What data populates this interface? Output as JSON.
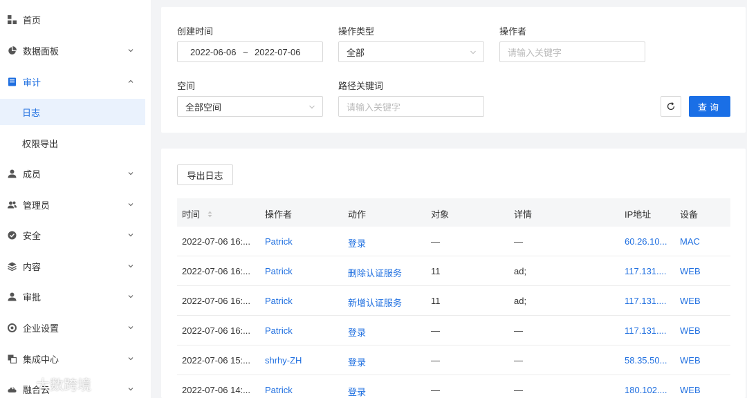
{
  "sidebar": {
    "items": [
      {
        "label": "首页",
        "icon": "grid-icon"
      },
      {
        "label": "数据面板",
        "icon": "pie-chart-icon"
      },
      {
        "label": "审计",
        "icon": "document-icon"
      },
      {
        "label": "日志"
      },
      {
        "label": "权限导出"
      },
      {
        "label": "成员",
        "icon": "user-icon"
      },
      {
        "label": "管理员",
        "icon": "admin-users-icon"
      },
      {
        "label": "安全",
        "icon": "shield-check-icon"
      },
      {
        "label": "内容",
        "icon": "layers-icon"
      },
      {
        "label": "审批",
        "icon": "approval-user-icon"
      },
      {
        "label": "企业设置",
        "icon": "settings-icon"
      },
      {
        "label": "集成中心",
        "icon": "integration-icon"
      },
      {
        "label": "融合云",
        "icon": "cloud-icon"
      }
    ]
  },
  "filters": {
    "created_time_label": "创建时间",
    "date_start": "2022-06-06",
    "date_sep": "~",
    "date_end": "2022-07-06",
    "op_type_label": "操作类型",
    "op_type_value": "全部",
    "operator_label": "操作者",
    "operator_placeholder": "请输入关键字",
    "space_label": "空间",
    "space_value": "全部空间",
    "path_label": "路径关键词",
    "path_placeholder": "请输入关键字",
    "query_button": "查询"
  },
  "list": {
    "export_button": "导出日志",
    "columns": [
      "时间",
      "操作者",
      "动作",
      "对象",
      "详情",
      "IP地址",
      "设备"
    ],
    "rows": [
      {
        "time": "2022-07-06 16:...",
        "operator": "Patrick",
        "action": "登录",
        "object": "—",
        "detail": "—",
        "ip": "60.26.10...",
        "device": "MAC"
      },
      {
        "time": "2022-07-06 16:...",
        "operator": "Patrick",
        "action": "删除认证服务",
        "object": "11",
        "detail": "ad;",
        "ip": "117.131....",
        "device": "WEB"
      },
      {
        "time": "2022-07-06 16:...",
        "operator": "Patrick",
        "action": "新增认证服务",
        "object": "11",
        "detail": "ad;",
        "ip": "117.131....",
        "device": "WEB"
      },
      {
        "time": "2022-07-06 16:...",
        "operator": "Patrick",
        "action": "登录",
        "object": "—",
        "detail": "—",
        "ip": "117.131....",
        "device": "WEB"
      },
      {
        "time": "2022-07-06 15:...",
        "operator": "shrhy-ZH",
        "action": "登录",
        "object": "—",
        "detail": "—",
        "ip": "58.35.50...",
        "device": "WEB"
      },
      {
        "time": "2022-07-06 14:...",
        "operator": "Patrick",
        "action": "登录",
        "object": "—",
        "detail": "—",
        "ip": "180.102....",
        "device": "WEB"
      }
    ]
  },
  "watermark": "大数跨境",
  "colors": {
    "accent": "#1a6fe6",
    "selected_bg": "#eaf2fd"
  }
}
